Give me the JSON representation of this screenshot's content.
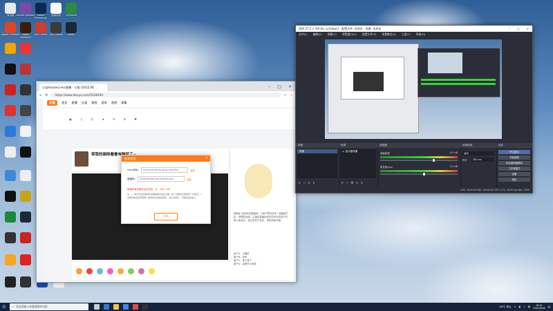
{
  "desktop": {
    "icons": [
      {
        "label": "浏览器",
        "color": "#e8e8e8"
      },
      {
        "label": "GitHub Desktop",
        "color": "#7a4aa8"
      },
      {
        "label": "Adobe Photoshop",
        "color": "#0a2a55"
      },
      {
        "label": "极速视频",
        "color": "#fafafa"
      },
      {
        "label": "Camtasia",
        "color": "#2a8c3c"
      },
      {
        "label": "Adobe Premiere",
        "color": "#e0451f"
      },
      {
        "label": "Adobe Illustrator",
        "color": "#3a1e0a"
      },
      {
        "label": "WPS Office",
        "color": "#d23c2a"
      },
      {
        "label": "OBS Studio",
        "color": "#3a3a3a"
      },
      {
        "label": "Steam",
        "color": "#1b2838"
      }
    ]
  },
  "browser": {
    "tab_title": "小五HackerLinks直播 - 斗鱼 (2022.06 ...",
    "url": "https://www.douyu.com/5228194",
    "logo": "斗鱼",
    "nav": [
      "首页",
      "直播",
      "分类",
      "视频",
      "游戏",
      "鱼吧",
      "赛事"
    ],
    "stream_title": "带我的猫咪看看电脑坏了~",
    "chat_text": "弹幕区 欢迎来到直播间！斗鱼严禁未成年人直播或打赏，请理性消费。主播在直播间发布的任何信息不代表斗鱼观点，请注意财产安全，谨防网络诈骗。",
    "chat_lines": [
      "用户A：主播好",
      "用户B：666",
      "用户C：来了来了",
      "用户D：这是什么软件"
    ]
  },
  "dialog": {
    "title": "推流信息",
    "close": "×",
    "server_label": "rtmp地址:",
    "server_value": "rtmp://sendtc3a.douyu.com/live",
    "key_label": "直播码:",
    "key_value": "5228194rWoOrwCq?wsSecret=...",
    "copy": "复制",
    "warning": "直播码有效期至后台关闭，IP：192.7.80",
    "notes": "注：1. 每次开启直播间前请确保推流设置正确，每个直播码仅能使用一次推流。2. 直播码泄露会导致他人使用您的直播间推流，请妥善保管，不要透露给他人。",
    "button": "关闭"
  },
  "obs": {
    "title": "OBS 27.2.1 (64 bit, windows) - 配置文件: 未命名 - 场景: 未命名",
    "menu": [
      "文件(F)",
      "编辑(E)",
      "视图(V)",
      "停靠窗口(D)",
      "配置文件(P)",
      "场景集合(S)",
      "工具(T)",
      "帮助(H)"
    ],
    "scenes_header": "场景",
    "scenes": [
      "场景"
    ],
    "sources_header": "来源",
    "sources": [
      "显示器采集"
    ],
    "mixer_header": "混音器",
    "mixer": [
      {
        "name": "桌面音频",
        "db": "0.0 dB",
        "level": 0.68
      },
      {
        "name": "麦克风/Aux",
        "db": "0.0 dB",
        "level": 0.55
      }
    ],
    "transitions_header": "转场特效",
    "transition": "淡出",
    "duration_label": "时长",
    "duration": "300 ms",
    "controls_header": "控件",
    "controls": [
      "停止推流",
      "开始录制",
      "启动虚拟摄像机",
      "工作室模式",
      "设置",
      "退出"
    ],
    "status": "LIVE: 00:00:05   REC: 00:00:00   CPU: 2.3%, 30.00 fps   kb/s: 2500"
  },
  "taskbar": {
    "search_placeholder": "在这里输入你要搜索的内容",
    "weather": "28°C 多云",
    "lang": "英",
    "time": "19:41",
    "date": "2022/4/26"
  }
}
